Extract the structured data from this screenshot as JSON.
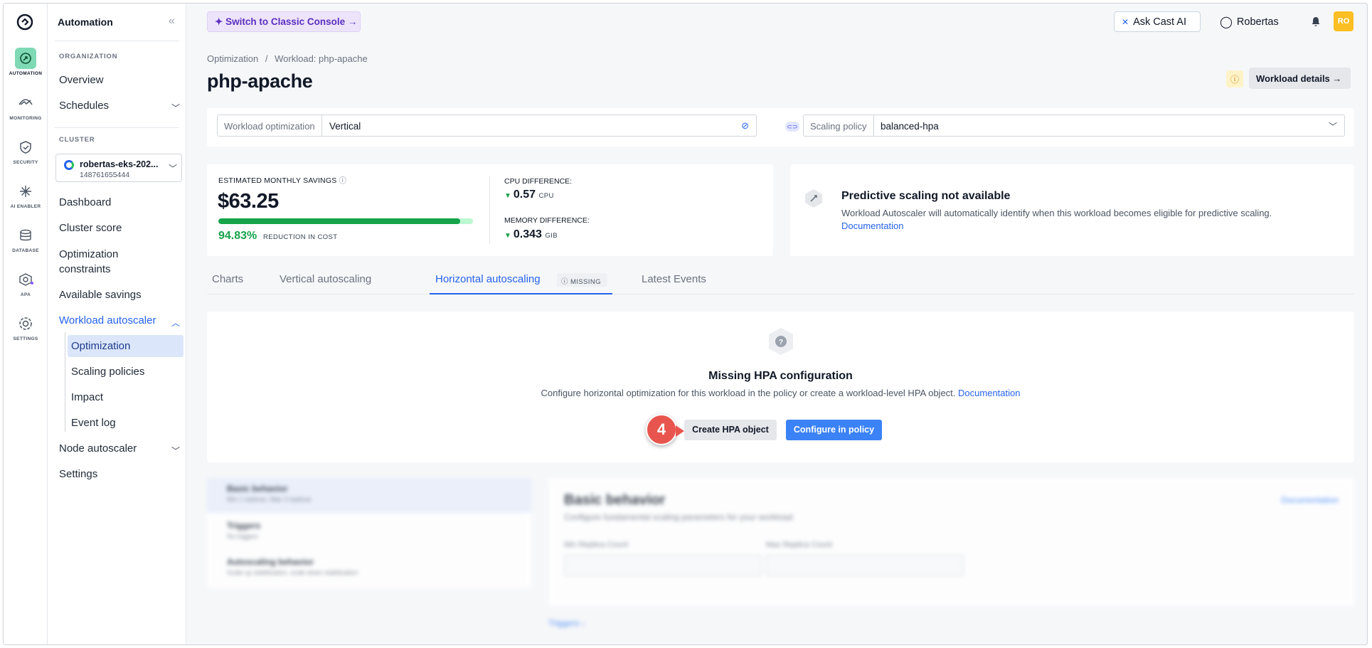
{
  "rail": [
    {
      "label": "AUTOMATION",
      "icon": "automation-icon",
      "active": true
    },
    {
      "label": "MONITORING",
      "icon": "monitoring-icon"
    },
    {
      "label": "SECURITY",
      "icon": "security-icon"
    },
    {
      "label": "AI ENABLER",
      "icon": "ai-enabler-icon"
    },
    {
      "label": "DATABASE",
      "icon": "database-icon"
    },
    {
      "label": "APA",
      "icon": "apa-icon"
    },
    {
      "label": "SETTINGS",
      "icon": "settings-icon"
    }
  ],
  "sidebar": {
    "title": "Automation",
    "org_section": "ORGANIZATION",
    "overview": "Overview",
    "schedules": "Schedules",
    "cluster_section": "CLUSTER",
    "cluster_name": "robertas-eks-202...",
    "cluster_id": "148761655444",
    "dashboard": "Dashboard",
    "cluster_score": "Cluster score",
    "optimization_constraints": "Optimization constraints",
    "available_savings": "Available savings",
    "workload_autoscaler": "Workload autoscaler",
    "sub": [
      "Optimization",
      "Scaling policies",
      "Impact",
      "Event log"
    ],
    "node_autoscaler": "Node autoscaler",
    "settings": "Settings"
  },
  "header": {
    "classic_console": "Switch to Classic Console",
    "ask_cast": "Ask Cast AI",
    "user": "Robertas",
    "avatar": "RO"
  },
  "breadcrumb": {
    "root": "Optimization",
    "sep": "/",
    "current": "Workload: php-apache"
  },
  "page_title": "php-apache",
  "workload_details": "Workload details",
  "optimization": {
    "label": "Workload optimization",
    "value": "Vertical",
    "policy_label": "Scaling policy",
    "policy_value": "balanced-hpa"
  },
  "savings": {
    "label": "ESTIMATED MONTHLY SAVINGS",
    "value": "$63.25",
    "progress_percent": 95,
    "reduction_pct": "94.83%",
    "reduction_label": "REDUCTION IN COST",
    "cpu_label": "CPU DIFFERENCE:",
    "cpu_value": "0.57",
    "cpu_unit": "CPU",
    "mem_label": "MEMORY DIFFERENCE:",
    "mem_value": "0.343",
    "mem_unit": "GIB"
  },
  "predictive": {
    "title": "Predictive scaling not available",
    "desc": "Workload Autoscaler will automatically identify when this workload becomes eligible for predictive scaling.",
    "link": "Documentation"
  },
  "tabs": {
    "charts": "Charts",
    "vertical": "Vertical autoscaling",
    "horizontal": "Horizontal autoscaling",
    "missing": "MISSING",
    "events": "Latest Events"
  },
  "hpa": {
    "title": "Missing HPA configuration",
    "desc": "Configure horizontal optimization for this workload in the policy or create a workload-level HPA object.",
    "link": "Documentation",
    "step": "4",
    "create": "Create HPA object",
    "configure": "Configure in policy"
  },
  "blurred": {
    "rows": [
      {
        "title": "Basic behavior",
        "sub": "Min 1 replicas, Max 3 replicas"
      },
      {
        "title": "Triggers",
        "sub": "No triggers"
      },
      {
        "title": "Autoscaling behavior",
        "sub": "Scale up stabilization, scale down stabilization"
      }
    ],
    "heading": "Basic behavior",
    "desc": "Configure fundamental scaling parameters for your workload",
    "doc": "Documentation",
    "min_label": "Min Replica Count",
    "max_label": "Max Replica Count",
    "triggers": "Triggers"
  }
}
